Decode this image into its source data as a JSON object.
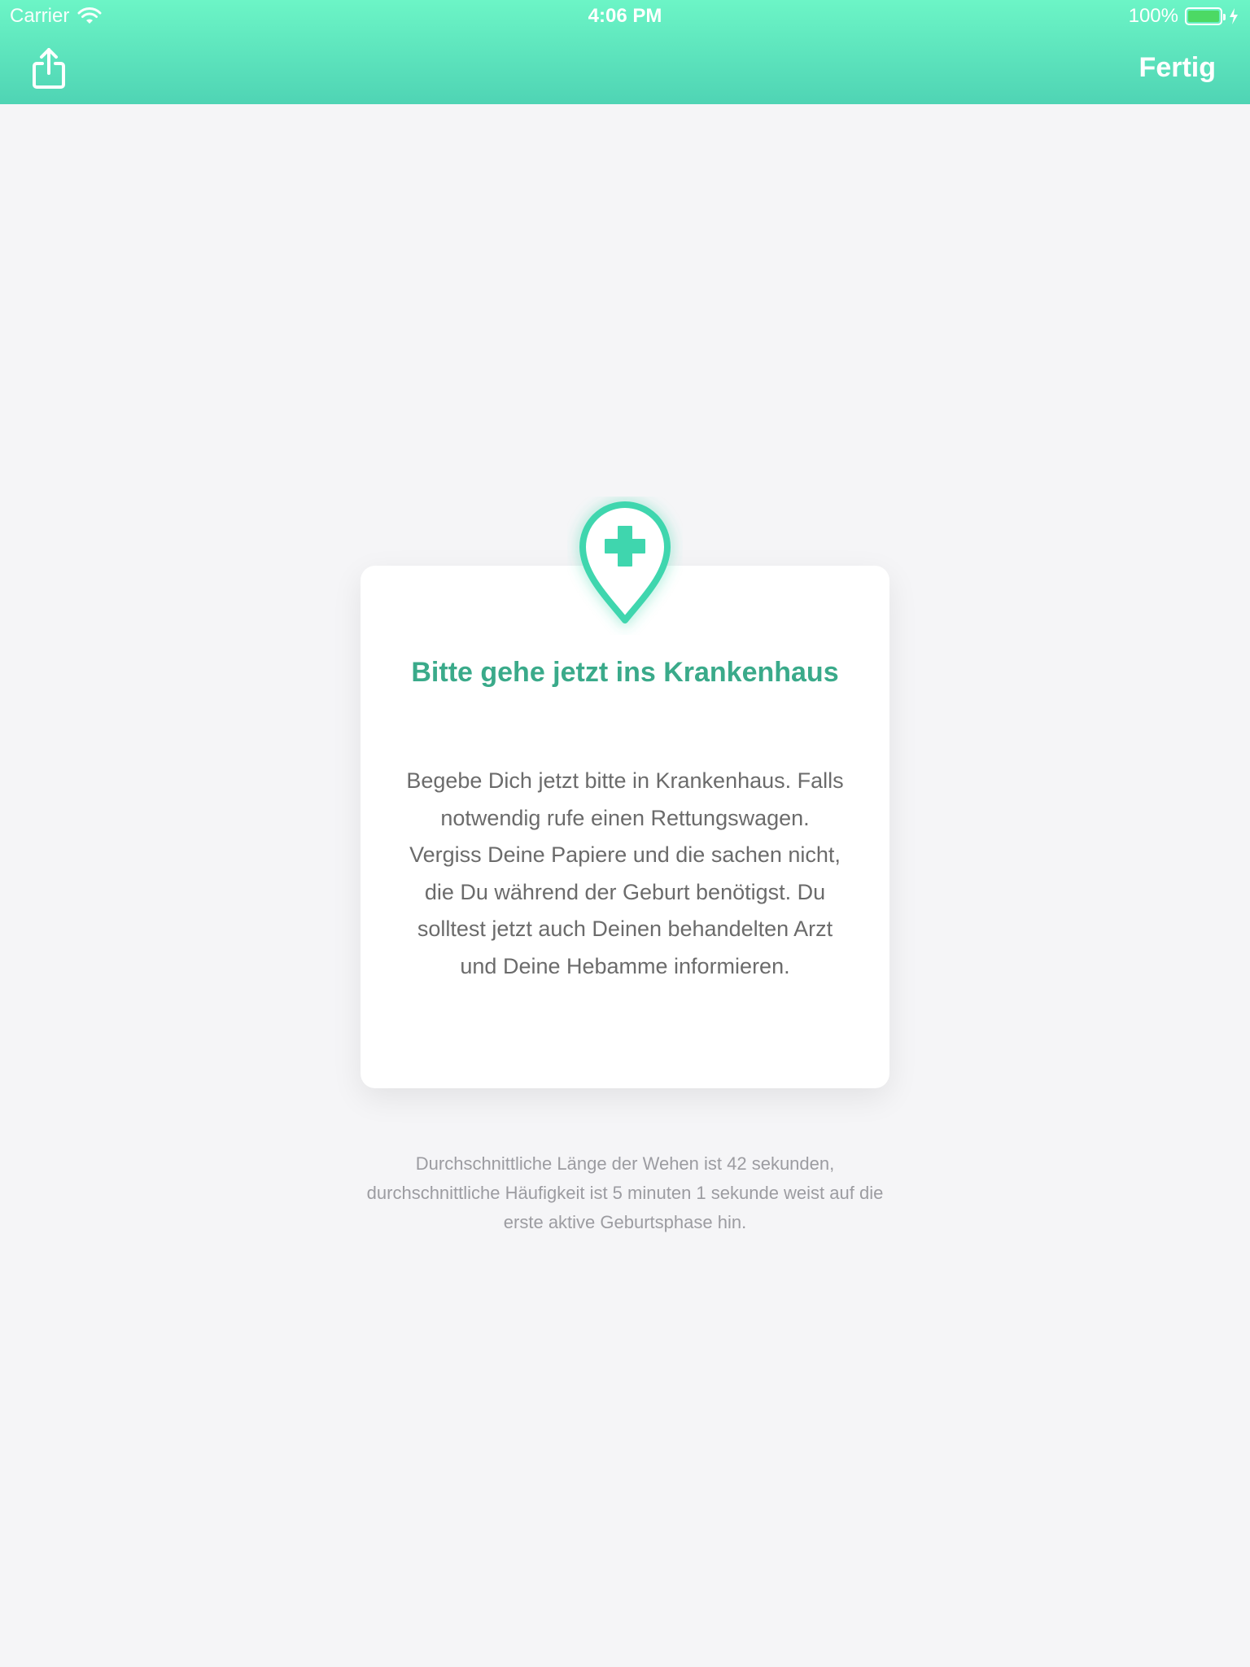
{
  "status_bar": {
    "carrier": "Carrier",
    "time": "4:06 PM",
    "battery_percent": "100%",
    "battery_level": 1.0,
    "battery_color": "#4cd964"
  },
  "nav": {
    "share_icon": "share-icon",
    "done_label": "Fertig"
  },
  "colors": {
    "accent": "#3fd6ae",
    "title": "#3aaa8a",
    "header_gradient_top": "#6cf5c6",
    "header_gradient_bottom": "#4fd4b4"
  },
  "card": {
    "icon": "hospital-location-pin-icon",
    "title": "Bitte gehe jetzt ins Krankenhaus",
    "body": "Begebe Dich jetzt bitte in Krankenhaus. Falls notwendig rufe einen Rettungswagen. Vergiss Deine Papiere und die sachen nicht, die Du während der Geburt benötigst. Du solltest jetzt auch Deinen behandelten Arzt und Deine Hebamme informieren."
  },
  "footer": {
    "note": "Durchschnittliche Länge der Wehen ist 42 sekunden, durchschnittliche Häufigkeit ist 5 minuten 1 sekunde weist auf die erste aktive Geburtsphase hin."
  }
}
